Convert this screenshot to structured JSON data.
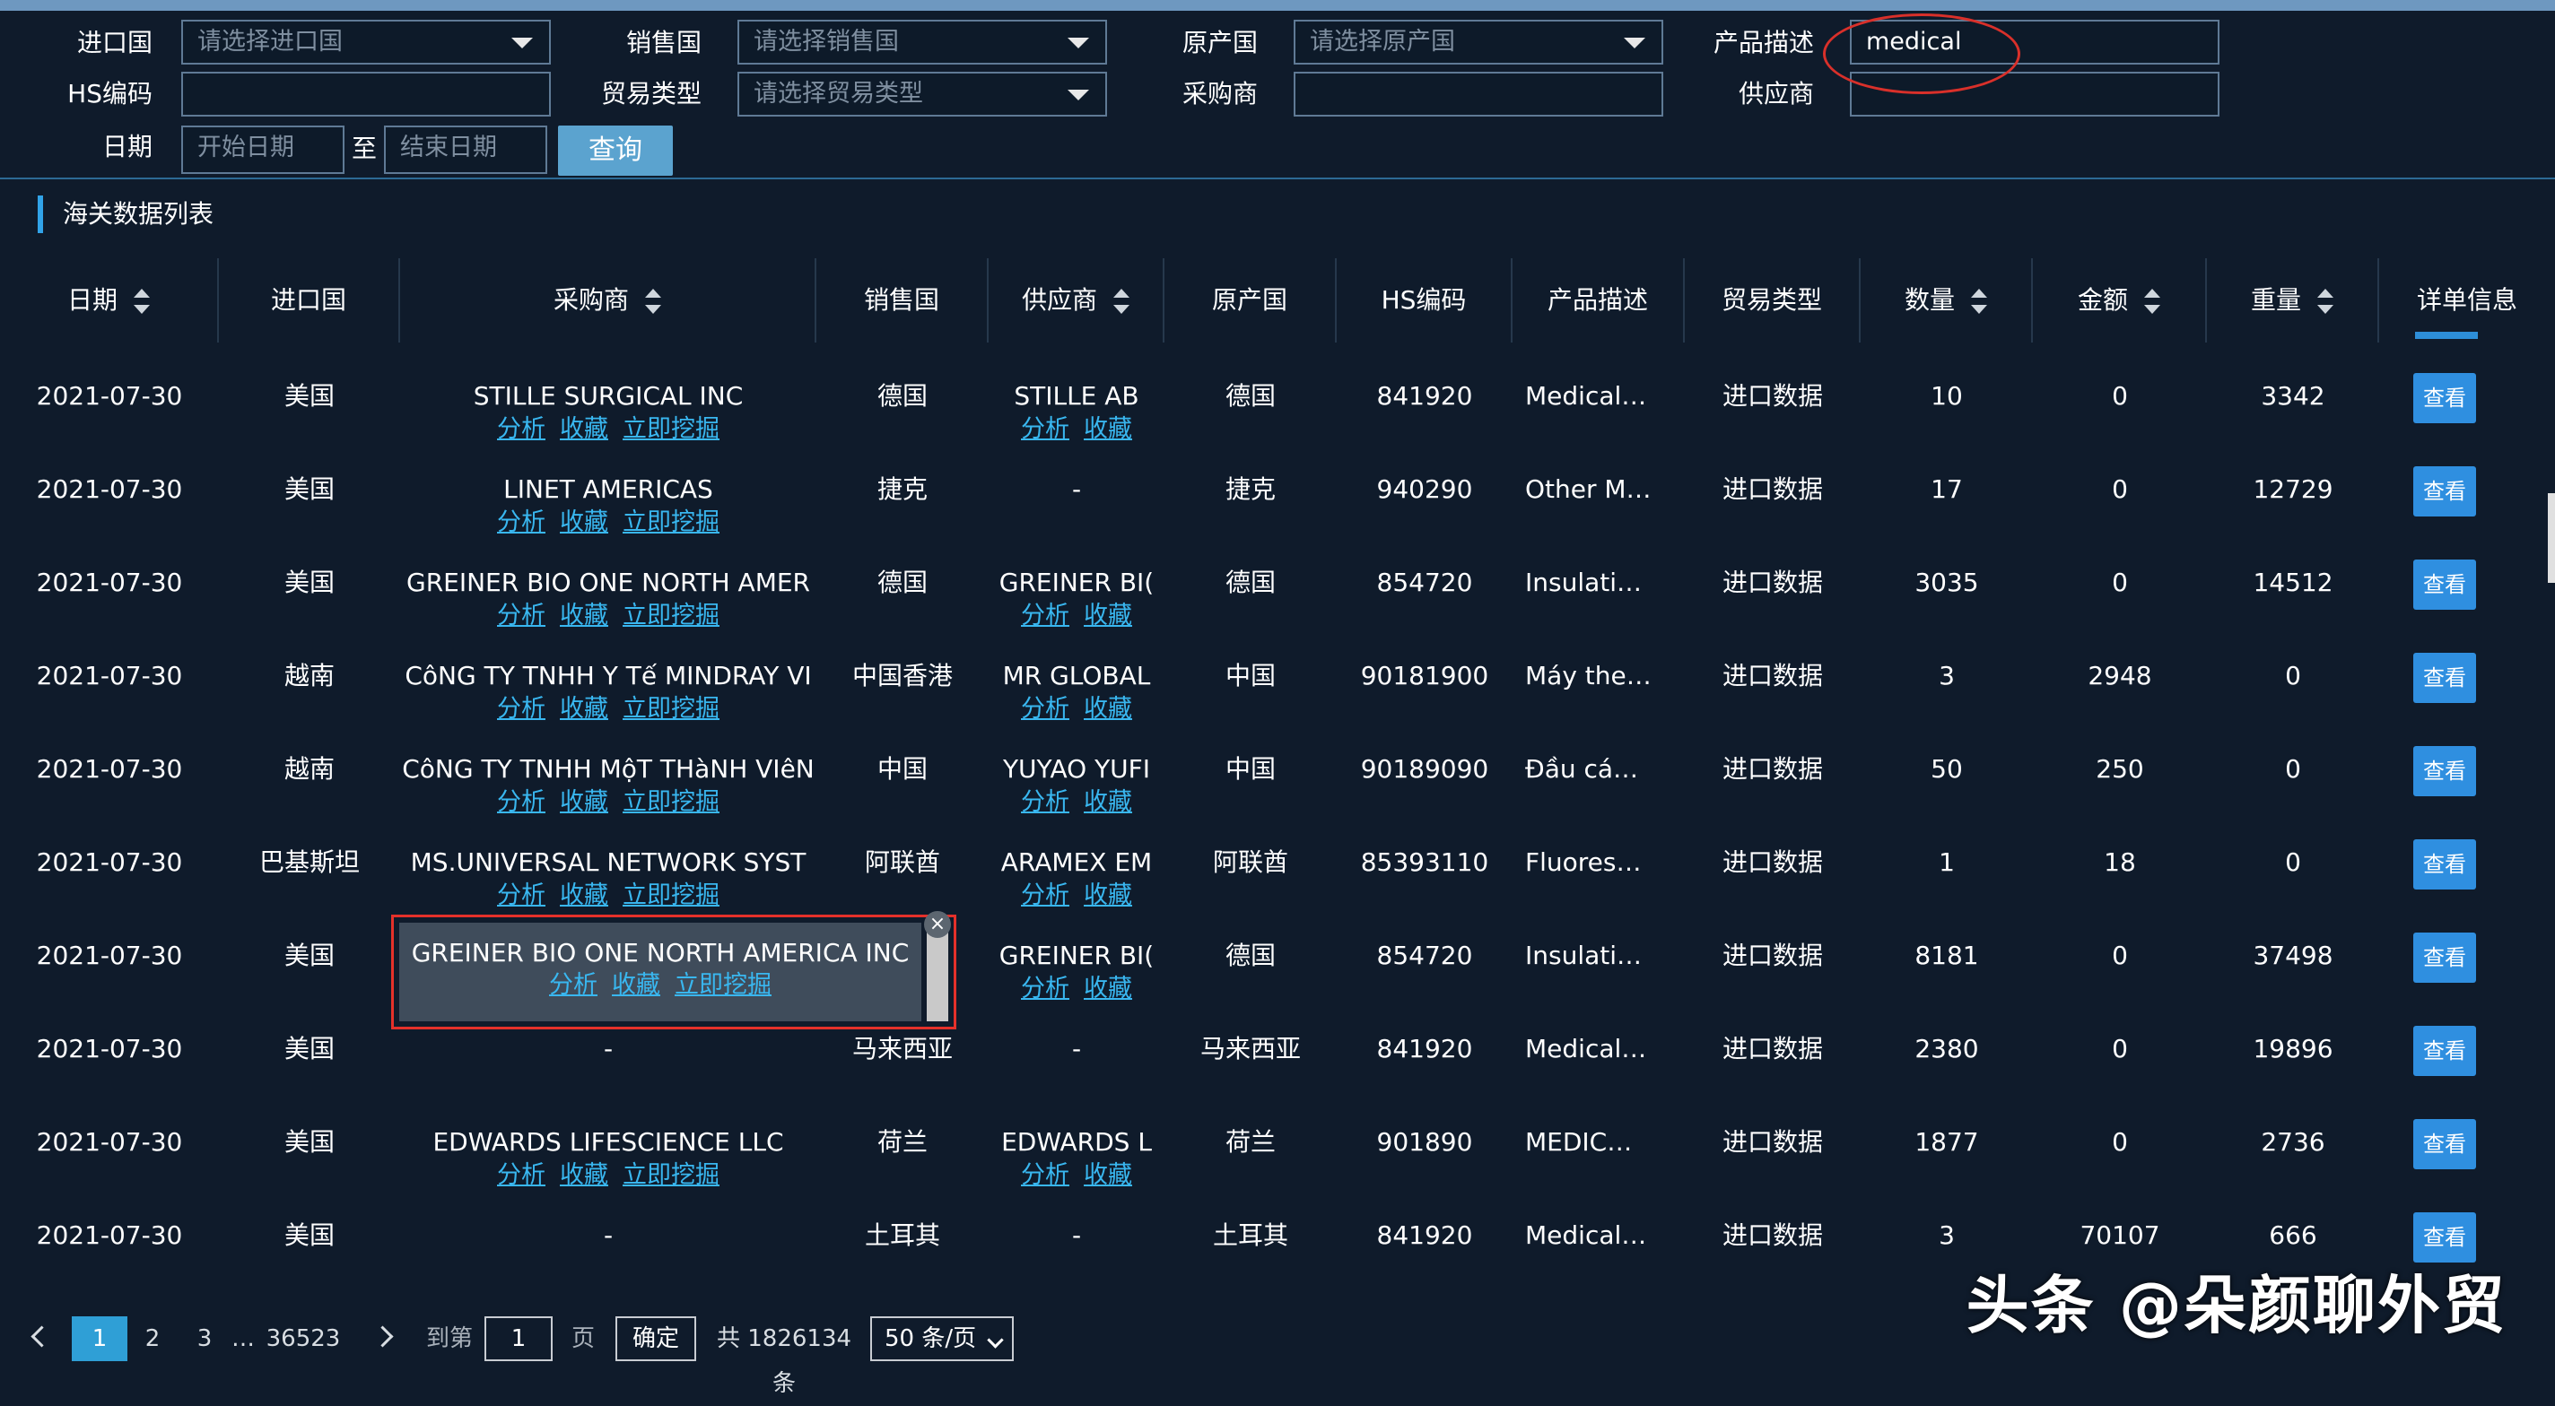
{
  "filters": {
    "import_country": {
      "label": "进口国",
      "placeholder": "请选择进口国"
    },
    "sales_country": {
      "label": "销售国",
      "placeholder": "请选择销售国"
    },
    "origin_country": {
      "label": "原产国",
      "placeholder": "请选择原产国"
    },
    "product_desc": {
      "label": "产品描述",
      "value": "medical"
    },
    "hs_code": {
      "label": "HS编码",
      "value": ""
    },
    "trade_type": {
      "label": "贸易类型",
      "placeholder": "请选择贸易类型"
    },
    "buyer": {
      "label": "采购商",
      "value": ""
    },
    "supplier": {
      "label": "供应商",
      "value": ""
    },
    "date": {
      "label": "日期",
      "start_placeholder": "开始日期",
      "to": "至",
      "end_placeholder": "结束日期"
    },
    "query_button": "查询"
  },
  "list_title": "海关数据列表",
  "columns": [
    "日期",
    "进口国",
    "采购商",
    "销售国",
    "供应商",
    "原产国",
    "HS编码",
    "产品描述",
    "贸易类型",
    "数量",
    "金额",
    "重量",
    "详单信息"
  ],
  "link_labels": {
    "analyze": "分析",
    "favorite": "收藏",
    "mine": "立即挖掘",
    "view": "查看"
  },
  "rows": [
    {
      "date": "2021-07-30",
      "import": "美国",
      "buyer": "STILLE SURGICAL INC",
      "sales": "德国",
      "supplier": "STILLE AB",
      "origin": "德国",
      "hs": "841920",
      "desc": "Medical…",
      "trade": "进口数据",
      "qty": "10",
      "amount": "0",
      "weight": "3342"
    },
    {
      "date": "2021-07-30",
      "import": "美国",
      "buyer": "LINET AMERICAS",
      "sales": "捷克",
      "supplier": "-",
      "origin": "捷克",
      "hs": "940290",
      "desc": "Other M…",
      "trade": "进口数据",
      "qty": "17",
      "amount": "0",
      "weight": "12729"
    },
    {
      "date": "2021-07-30",
      "import": "美国",
      "buyer": "GREINER BIO ONE NORTH AMER",
      "sales": "德国",
      "supplier": "GREINER BI(",
      "origin": "德国",
      "hs": "854720",
      "desc": "Insulati…",
      "trade": "进口数据",
      "qty": "3035",
      "amount": "0",
      "weight": "14512"
    },
    {
      "date": "2021-07-30",
      "import": "越南",
      "buyer": "CôNG TY TNHH Y Tế MINDRAY VI",
      "sales": "中国香港",
      "supplier": "MR GLOBAL",
      "origin": "中国",
      "hs": "90181900",
      "desc": "Máy the…",
      "trade": "进口数据",
      "qty": "3",
      "amount": "2948",
      "weight": "0"
    },
    {
      "date": "2021-07-30",
      "import": "越南",
      "buyer": "CôNG TY TNHH MộT THàNH VIêN",
      "sales": "中国",
      "supplier": "YUYAO YUFI",
      "origin": "中国",
      "hs": "90189090",
      "desc": "Đầu cá…",
      "trade": "进口数据",
      "qty": "50",
      "amount": "250",
      "weight": "0"
    },
    {
      "date": "2021-07-30",
      "import": "巴基斯坦",
      "buyer": "MS.UNIVERSAL NETWORK SYST",
      "sales": "阿联酋",
      "supplier": "ARAMEX EM",
      "origin": "阿联酋",
      "hs": "85393110",
      "desc": "Fluores…",
      "trade": "进口数据",
      "qty": "1",
      "amount": "18",
      "weight": "0"
    },
    {
      "date": "2021-07-30",
      "import": "美国",
      "buyer": "GREINER BIO ONE NORTH AMERICA INC",
      "sales": "",
      "supplier": "GREINER BI(",
      "origin": "德国",
      "hs": "854720",
      "desc": "Insulati…",
      "trade": "进口数据",
      "qty": "8181",
      "amount": "0",
      "weight": "37498"
    },
    {
      "date": "2021-07-30",
      "import": "美国",
      "buyer": "-",
      "sales": "马来西亚",
      "supplier": "-",
      "origin": "马来西亚",
      "hs": "841920",
      "desc": "Medical…",
      "trade": "进口数据",
      "qty": "2380",
      "amount": "0",
      "weight": "19896"
    },
    {
      "date": "2021-07-30",
      "import": "美国",
      "buyer": "EDWARDS LIFESCIENCE LLC",
      "sales": "荷兰",
      "supplier": "EDWARDS L",
      "origin": "荷兰",
      "hs": "901890",
      "desc": "MEDIC…",
      "trade": "进口数据",
      "qty": "1877",
      "amount": "0",
      "weight": "2736"
    },
    {
      "date": "2021-07-30",
      "import": "美国",
      "buyer": "-",
      "sales": "土耳其",
      "supplier": "-",
      "origin": "土耳其",
      "hs": "841920",
      "desc": "Medical…",
      "trade": "进口数据",
      "qty": "3",
      "amount": "70107",
      "weight": "666"
    }
  ],
  "pagination": {
    "pages": [
      "1",
      "2",
      "3"
    ],
    "ellipsis": "…",
    "last": "36523",
    "goto": "到第",
    "goto_value": "1",
    "page_unit": "页",
    "confirm": "确定",
    "total": "共 1826134 条",
    "page_size": "50 条/页"
  },
  "watermark": "头条 @朵颜聊外贸"
}
